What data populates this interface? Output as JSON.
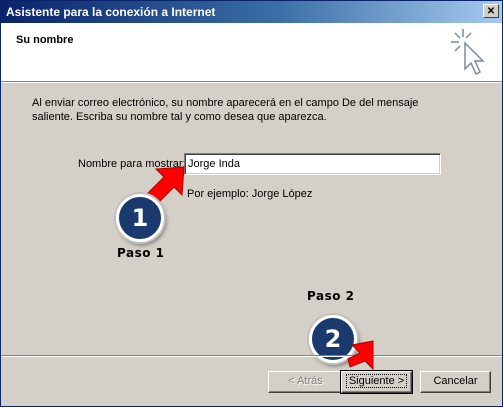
{
  "window": {
    "title": "Asistente para la conexión a Internet",
    "close_glyph": "✕"
  },
  "header": {
    "step_title": "Su nombre",
    "icon": "wizard-cursor-icon"
  },
  "body": {
    "intro": "Al enviar correo electrónico, su nombre aparecerá en el campo De del mensaje saliente. Escriba su nombre tal y como desea que aparezca.",
    "field_label": "Nombre para mostrar:",
    "field_value": "Jorge Inda",
    "example": "Por ejemplo: Jorge López"
  },
  "annotations": {
    "step1_number": "1",
    "step1_label": "Paso 1",
    "step2_number": "2",
    "step2_label": "Paso 2",
    "arrow_color": "#ff0000",
    "badge_color": "#1a3a6e"
  },
  "buttons": {
    "back": "< Atrás",
    "next": "Siguiente >",
    "cancel": "Cancelar"
  },
  "colors": {
    "titlebar_start": "#0a246a",
    "titlebar_end": "#a6caf0",
    "dialog_bg": "#d4d0c8"
  }
}
